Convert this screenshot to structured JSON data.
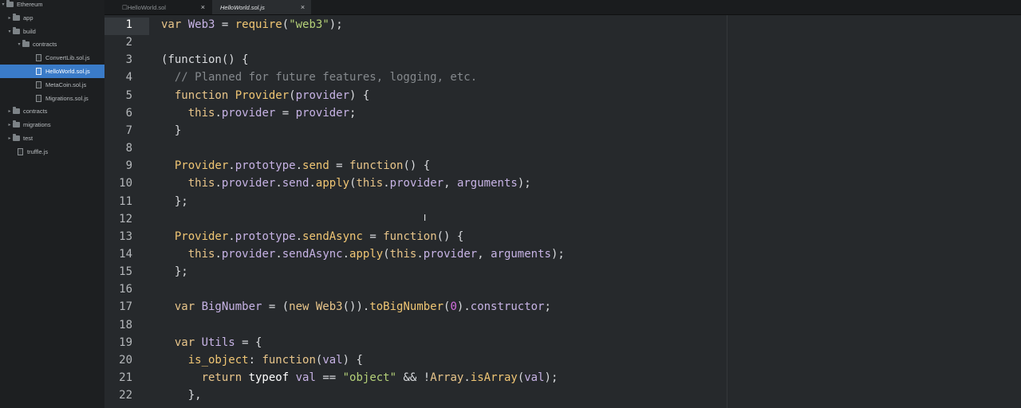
{
  "sidebar": {
    "items": [
      {
        "label": "Ethereum",
        "type": "folder",
        "expanded": true,
        "depth": 0
      },
      {
        "label": "app",
        "type": "folder",
        "expanded": false,
        "depth": 1
      },
      {
        "label": "build",
        "type": "folder",
        "expanded": true,
        "depth": 1
      },
      {
        "label": "contracts",
        "type": "folder",
        "expanded": true,
        "depth": 2
      },
      {
        "label": "ConvertLib.sol.js",
        "type": "file",
        "depth": 3
      },
      {
        "label": "HelloWorld.sol.js",
        "type": "file",
        "depth": 3,
        "selected": true
      },
      {
        "label": "MetaCoin.sol.js",
        "type": "file",
        "depth": 3
      },
      {
        "label": "Migrations.sol.js",
        "type": "file",
        "depth": 3
      },
      {
        "label": "contracts",
        "type": "folder",
        "expanded": false,
        "depth": 1
      },
      {
        "label": "migrations",
        "type": "folder",
        "expanded": false,
        "depth": 1
      },
      {
        "label": "test",
        "type": "folder",
        "expanded": false,
        "depth": 1
      },
      {
        "label": "truffle.js",
        "type": "file",
        "depth": 1
      }
    ]
  },
  "tabs": [
    {
      "label": "☐HelloWorld.sol",
      "active": false,
      "close": "×"
    },
    {
      "label": "HelloWorld.sol.js",
      "active": true,
      "close": "×"
    }
  ],
  "editor": {
    "current_line": 1,
    "lines": [
      {
        "n": "1",
        "tokens": [
          [
            "k",
            "var "
          ],
          [
            "id",
            "Web3"
          ],
          [
            "p",
            " = "
          ],
          [
            "fn",
            "require"
          ],
          [
            "p",
            "("
          ],
          [
            "s",
            "\"web3\""
          ],
          [
            "p",
            ");"
          ]
        ]
      },
      {
        "n": "2",
        "tokens": []
      },
      {
        "n": "3",
        "tokens": [
          [
            "p",
            "(function() {"
          ]
        ]
      },
      {
        "n": "4",
        "tokens": [
          [
            "c",
            "  // Planned for future features, logging, etc."
          ]
        ]
      },
      {
        "n": "5",
        "tokens": [
          [
            "k",
            "  function "
          ],
          [
            "fn",
            "Provider"
          ],
          [
            "p",
            "("
          ],
          [
            "id",
            "provider"
          ],
          [
            "p",
            ") {"
          ]
        ]
      },
      {
        "n": "6",
        "tokens": [
          [
            "k",
            "    this"
          ],
          [
            "p",
            "."
          ],
          [
            "id",
            "provider"
          ],
          [
            "p",
            " = "
          ],
          [
            "id",
            "provider"
          ],
          [
            "p",
            ";"
          ]
        ]
      },
      {
        "n": "7",
        "tokens": [
          [
            "p",
            "  }"
          ]
        ]
      },
      {
        "n": "8",
        "tokens": []
      },
      {
        "n": "9",
        "tokens": [
          [
            "fn",
            "  Provider"
          ],
          [
            "p",
            "."
          ],
          [
            "id",
            "prototype"
          ],
          [
            "p",
            "."
          ],
          [
            "fn",
            "send"
          ],
          [
            "p",
            " = "
          ],
          [
            "k",
            "function"
          ],
          [
            "p",
            "() {"
          ]
        ]
      },
      {
        "n": "10",
        "tokens": [
          [
            "k",
            "    this"
          ],
          [
            "p",
            "."
          ],
          [
            "id",
            "provider"
          ],
          [
            "p",
            "."
          ],
          [
            "id",
            "send"
          ],
          [
            "p",
            "."
          ],
          [
            "fn",
            "apply"
          ],
          [
            "p",
            "("
          ],
          [
            "k",
            "this"
          ],
          [
            "p",
            "."
          ],
          [
            "id",
            "provider"
          ],
          [
            "p",
            ", "
          ],
          [
            "id",
            "arguments"
          ],
          [
            "p",
            ");"
          ]
        ]
      },
      {
        "n": "11",
        "tokens": [
          [
            "p",
            "  };"
          ]
        ]
      },
      {
        "n": "12",
        "tokens": []
      },
      {
        "n": "13",
        "tokens": [
          [
            "fn",
            "  Provider"
          ],
          [
            "p",
            "."
          ],
          [
            "id",
            "prototype"
          ],
          [
            "p",
            "."
          ],
          [
            "fn",
            "sendAsync"
          ],
          [
            "p",
            " = "
          ],
          [
            "k",
            "function"
          ],
          [
            "p",
            "() {"
          ]
        ]
      },
      {
        "n": "14",
        "tokens": [
          [
            "k",
            "    this"
          ],
          [
            "p",
            "."
          ],
          [
            "id",
            "provider"
          ],
          [
            "p",
            "."
          ],
          [
            "id",
            "sendAsync"
          ],
          [
            "p",
            "."
          ],
          [
            "fn",
            "apply"
          ],
          [
            "p",
            "("
          ],
          [
            "k",
            "this"
          ],
          [
            "p",
            "."
          ],
          [
            "id",
            "provider"
          ],
          [
            "p",
            ", "
          ],
          [
            "id",
            "arguments"
          ],
          [
            "p",
            ");"
          ]
        ]
      },
      {
        "n": "15",
        "tokens": [
          [
            "p",
            "  };"
          ]
        ]
      },
      {
        "n": "16",
        "tokens": []
      },
      {
        "n": "17",
        "tokens": [
          [
            "k",
            "  var "
          ],
          [
            "id",
            "BigNumber"
          ],
          [
            "p",
            " = ("
          ],
          [
            "k",
            "new "
          ],
          [
            "tp",
            "Web3"
          ],
          [
            "p",
            "())."
          ],
          [
            "fn",
            "toBigNumber"
          ],
          [
            "p",
            "("
          ],
          [
            "nm",
            "0"
          ],
          [
            "p",
            ")."
          ],
          [
            "id",
            "constructor"
          ],
          [
            "p",
            ";"
          ]
        ]
      },
      {
        "n": "18",
        "tokens": []
      },
      {
        "n": "19",
        "tokens": [
          [
            "k",
            "  var "
          ],
          [
            "id",
            "Utils"
          ],
          [
            "p",
            " = {"
          ]
        ]
      },
      {
        "n": "20",
        "tokens": [
          [
            "fn",
            "    is_object"
          ],
          [
            "p",
            ": "
          ],
          [
            "k",
            "function"
          ],
          [
            "p",
            "("
          ],
          [
            "id",
            "val"
          ],
          [
            "p",
            ") {"
          ]
        ]
      },
      {
        "n": "21",
        "tokens": [
          [
            "k",
            "      return "
          ],
          [
            "bl",
            "typeof "
          ],
          [
            "id",
            "val"
          ],
          [
            "p",
            " == "
          ],
          [
            "s",
            "\"object\""
          ],
          [
            "p",
            " && !"
          ],
          [
            "tp",
            "Array"
          ],
          [
            "p",
            "."
          ],
          [
            "fn",
            "isArray"
          ],
          [
            "p",
            "("
          ],
          [
            "id",
            "val"
          ],
          [
            "p",
            ");"
          ]
        ]
      },
      {
        "n": "22",
        "tokens": [
          [
            "p",
            "    },"
          ]
        ]
      }
    ]
  },
  "cursor_glyph": "Ι",
  "colors": {
    "sidebar_bg": "#1d1f21",
    "selection": "#3a7bc8",
    "editor_bg": "#26292c",
    "keyword": "#e8c58a",
    "string": "#b5d178",
    "comment": "#85898d",
    "number": "#d46ee0"
  }
}
